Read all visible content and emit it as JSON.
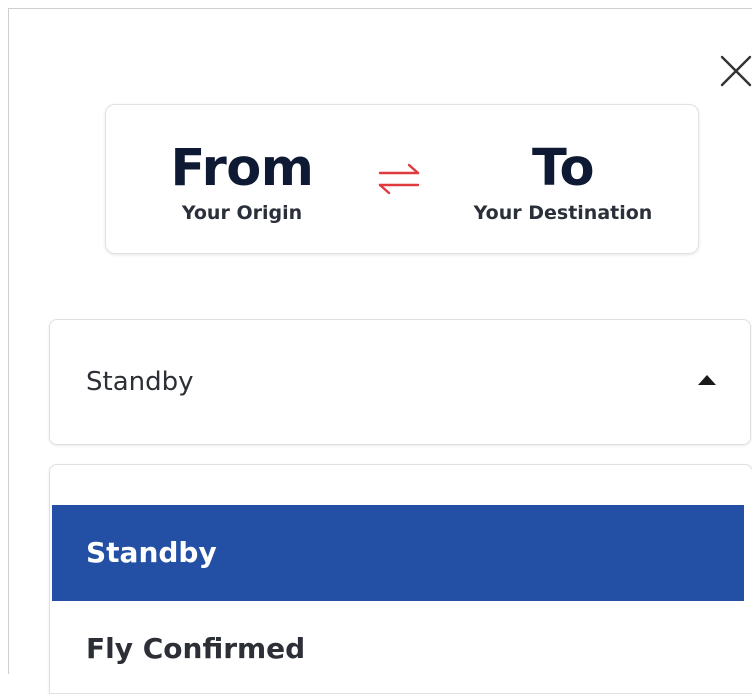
{
  "route": {
    "from_label": "From",
    "from_sublabel": "Your Origin",
    "to_label": "To",
    "to_sublabel": "Your Destination",
    "swap_icon": "swap-arrows-icon",
    "swap_color": "#e0393e"
  },
  "close_icon": "close-icon",
  "fare_select": {
    "selected_value": "Standby",
    "expanded": true,
    "options": [
      {
        "label": "Standby",
        "selected": true
      },
      {
        "label": "Fly Confirmed",
        "selected": false
      }
    ]
  },
  "colors": {
    "selected_option_bg": "#2350a5",
    "selected_option_text": "#ffffff",
    "heading_text": "#0e1a33"
  }
}
